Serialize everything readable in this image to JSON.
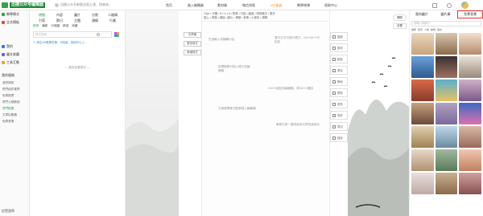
{
  "app": {
    "logo_text": "迅捷公众号编辑器"
  },
  "notice": {
    "text": "迅捷公众号新版全面上线，快来体..."
  },
  "topnav": [
    {
      "label": "首页",
      "highlight": false
    },
    {
      "label": "進入編輯器",
      "highlight": false
    },
    {
      "label": "素材庫",
      "highlight": false
    },
    {
      "label": "微信排版",
      "highlight": false
    },
    {
      "label": "VIP會員",
      "highlight": true
    },
    {
      "label": "教學視頻",
      "highlight": false
    },
    {
      "label": "幫助中心",
      "highlight": false
    }
  ],
  "leftnav": {
    "items": [
      {
        "label": "教學模式",
        "icon": "styles-icon",
        "color": "green"
      },
      {
        "label": "全文模板",
        "icon": "template-icon",
        "color": "red"
      },
      {
        "label": "我的",
        "icon": "user-icon",
        "color": "blue"
      },
      {
        "label": "圖文收藏",
        "icon": "collect-icon",
        "color": "purple"
      },
      {
        "label": "工具互動",
        "icon": "tools-icon",
        "color": "orange"
      }
    ],
    "sub_a": [
      {
        "label": "我的導航",
        "green": false
      },
      {
        "label": "熱門組件推薦",
        "green": false
      },
      {
        "label": "免費推薦",
        "green": false
      },
      {
        "label": "熱門公號數據",
        "green": false
      },
      {
        "label": "熱門推廣",
        "green": true
      },
      {
        "label": "文章採集器",
        "green": false
      },
      {
        "label": "免費音樂",
        "green": false
      }
    ],
    "section_head": "我的服務",
    "bottom": "設置選單"
  },
  "stylepanel": {
    "categories": [
      "標題",
      "內容",
      "圖片",
      "分割",
      "二維碼",
      "引導",
      "節日",
      "主題",
      "頭條",
      "行業"
    ],
    "active_index": 0,
    "filters": [
      "推荐",
      "最新",
      "已收藏",
      "精选",
      "收藏"
    ],
    "active_filter": 0,
    "search_placeholder": "樣式搜索",
    "hint": "※ 按住Ctrl點擊多選，可批量，請操作以上...",
    "empty_text": "— 當前查看樣式 —"
  },
  "side_buttons": [
    "文章模",
    "更多樣式",
    "新增樣式"
  ],
  "editor": {
    "toolbar_row1": "13px • 字體 • B I U • A • 對齊 • 行距 • 縮進 • 清除格式 • 更多",
    "toolbar_row2": "插入 • 表格 • 鏈接 • 圖片 • 視頻 • 音樂 • 小程序 • 源碼",
    "tips": [
      "在這輸入或編輯內容",
      "選中文字可進行樣式，Ctrl+Alt+V可粘貼",
      "鼠標點擊可插入樣式到編輯器",
      "Ctrl+V粘貼到編輯器，按Ctrl+Z撤回",
      "左側選擇樣式點擊插入編輯器",
      "單擊右側一鍵排版將文章快速美化"
    ]
  },
  "sidetools": [
    {
      "label": "复制",
      "icon": "copy-icon"
    },
    {
      "label": "剪切",
      "icon": "cut-icon"
    },
    {
      "label": "粘贴",
      "icon": "paste-icon"
    },
    {
      "label": "清空",
      "icon": "clear-icon"
    },
    {
      "label": "换色",
      "icon": "color-icon"
    },
    {
      "label": "预览",
      "icon": "preview-icon"
    },
    {
      "label": "发布",
      "icon": "publish-icon"
    },
    {
      "label": "同步",
      "icon": "sync-icon"
    },
    {
      "label": "导出",
      "icon": "export-icon"
    },
    {
      "label": "保存",
      "icon": "save-icon"
    }
  ],
  "fab": {
    "label": "關閉",
    "label2": "设置"
  },
  "imgpanel": {
    "tabs": [
      "我的圖片",
      "圖片庫",
      "免費背景"
    ],
    "selected_tab": 2,
    "search_placeholder": "請輸入關鍵字",
    "tags": [
      "推薦",
      "風景",
      "人物",
      "動物",
      "美食"
    ]
  },
  "colors": {
    "brand": "#2fa44f",
    "accent_orange": "#ff8c1a",
    "select_red": "#e33"
  }
}
